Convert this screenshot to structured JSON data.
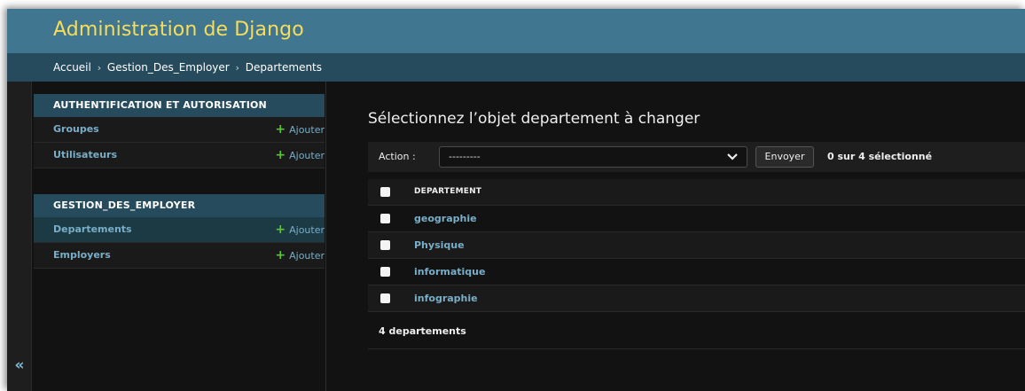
{
  "header": {
    "site_title": "Administration de Django"
  },
  "breadcrumbs": {
    "home": "Accueil",
    "app": "Gestion_Des_Employer",
    "current": "Departements",
    "separator": "›"
  },
  "nav_toggle": {
    "label": "«"
  },
  "sidebar": {
    "modules": [
      {
        "caption": "AUTHENTIFICATION ET AUTORISATION",
        "rows": [
          {
            "name": "Groupes",
            "add_label": "Ajouter",
            "active": false
          },
          {
            "name": "Utilisateurs",
            "add_label": "Ajouter",
            "active": false
          }
        ]
      },
      {
        "caption": "GESTION_DES_EMPLOYER",
        "rows": [
          {
            "name": "Departements",
            "add_label": "Ajouter",
            "active": true
          },
          {
            "name": "Employers",
            "add_label": "Ajouter",
            "active": false
          }
        ]
      }
    ]
  },
  "main": {
    "title": "Sélectionnez l’objet departement à changer",
    "actions": {
      "label": "Action :",
      "selected_option": "---------",
      "go_label": "Envoyer",
      "counter": "0 sur 4 sélectionné"
    },
    "table": {
      "column_header": "DEPARTEMENT",
      "rows": [
        "geographie",
        "Physique",
        "informatique",
        "infographie"
      ]
    },
    "paginator": "4 departements"
  },
  "colors": {
    "header_bg": "#417690",
    "title_yellow": "#f5dd5d",
    "breadcrumb_bg": "#264b5d",
    "link_blue": "#79aec8",
    "add_green": "#5fbf3f",
    "background": "#121212"
  }
}
